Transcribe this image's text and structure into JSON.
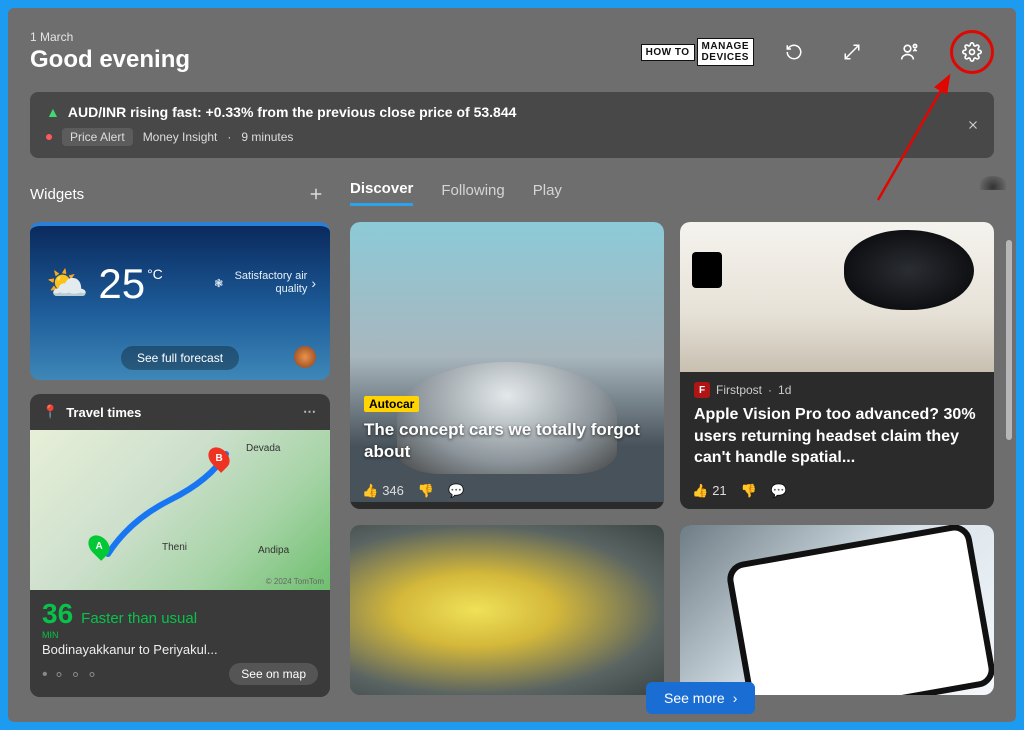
{
  "header": {
    "date": "1 March",
    "greeting": "Good evening"
  },
  "watermark": {
    "prefix": "HOW TO",
    "line1": "MANAGE",
    "line2": "DEVICES"
  },
  "notification": {
    "headline": "AUD/INR rising fast: +0.33% from the previous close price of 53.844",
    "tag": "Price Alert",
    "source": "Money Insight",
    "time": "9 minutes"
  },
  "widgets": {
    "heading": "Widgets",
    "weather": {
      "temp": "25",
      "unit": "°C",
      "air_quality_label": "Satisfactory air quality",
      "forecast_label": "See full forecast"
    },
    "travel": {
      "title": "Travel times",
      "eta_value": "36",
      "eta_unit": "MIN",
      "status": "Faster than usual",
      "route_label": "Bodinayakkanur to Periyakul...",
      "see_map_label": "See on map",
      "map_places": {
        "a": "Theni",
        "b": "Devada",
        "c": "Andipa",
        "credit": "© 2024 TomTom"
      }
    }
  },
  "feed": {
    "tabs": {
      "discover": "Discover",
      "following": "Following",
      "play": "Play"
    },
    "see_more": "See more",
    "cards": [
      {
        "source": "Autocar",
        "title": "The concept cars we totally forgot about",
        "likes": "346"
      },
      {
        "source": "Firstpost",
        "source_time": "1d",
        "title": "Apple Vision Pro too advanced? 30% users returning headset claim they can't handle spatial...",
        "likes": "21"
      }
    ]
  }
}
